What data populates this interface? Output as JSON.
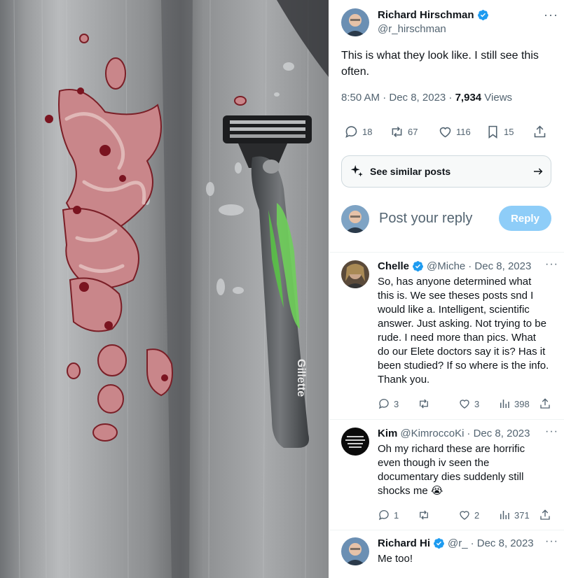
{
  "media": {
    "alt": "",
    "brand_text": "Gillette"
  },
  "tweet": {
    "author_name": "Richard Hirschman",
    "author_handle": "@r_hirschman",
    "text": "This is what they look like. I still see this often.",
    "time": "8:50 AM · Dec 8, 2023 · ",
    "views_count": "7,934",
    "views_label": " Views",
    "replies": "18",
    "reposts": "67",
    "likes": "116",
    "bookmarks": "15"
  },
  "similar": {
    "label": "See similar posts"
  },
  "reply_box": {
    "placeholder": "Post your reply",
    "button": "Reply"
  },
  "replies": [
    {
      "name": "Chelle",
      "handle": "@Miche",
      "date": "· Dec 8, 2023",
      "text": "So, has anyone determined what this is.  We see theses posts snd I would like a. Intelligent, scientific answer.  Just asking. Not trying to be rude.   I need more than pics.  What do our Elete doctors say it is?  Has it been studied?  If so where is the info.  Thank you.",
      "replies": "3",
      "reposts": "",
      "likes": "3",
      "views": "398"
    },
    {
      "name": "Kim",
      "handle": "@KimroccoKi",
      "date": "· Dec 8, 2023",
      "text": "Oh my richard these are horrific even though iv seen the documentary dies suddenly still shocks me 😭",
      "replies": "1",
      "reposts": "",
      "likes": "2",
      "views": "371"
    },
    {
      "name": "Richard Hi",
      "handle": "@r_",
      "date": "· Dec 8, 2023",
      "text": "Me too!",
      "replies": "",
      "reposts": "",
      "likes": "",
      "views": ""
    }
  ],
  "colors": {
    "accent": "#1d9bf0",
    "reply_button": "#8ecdf8",
    "text_secondary": "#536471"
  }
}
